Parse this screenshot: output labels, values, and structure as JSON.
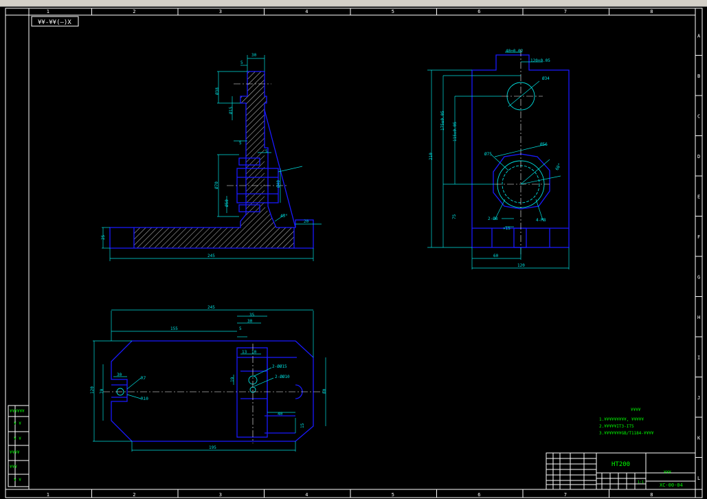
{
  "sheet": {
    "col_labels": [
      "1",
      "2",
      "3",
      "4",
      "5",
      "6",
      "7",
      "8"
    ],
    "row_labels": [
      "A",
      "B",
      "C",
      "D",
      "E",
      "F",
      "G",
      "H",
      "I",
      "J",
      "K",
      "L"
    ],
    "view_label": "¥¥-¥¥(—)X",
    "left_strip": [
      "¥¥¥¥¥¥",
      "¥ ¥",
      "¥ ¥",
      "¥¥¥¥",
      "¥¥¥",
      "¥ ¥"
    ]
  },
  "front_view": {
    "dims": {
      "top_width": "30",
      "top_step": "5",
      "dia_upper": "Ø38",
      "dia_upper2": "Ø15",
      "step_mid": "5",
      "step_mid2": "5",
      "dia_bore": "Ø40",
      "dia_side": "Ø70",
      "dia_low": "Ø50",
      "base_height": "25",
      "total_width": "245",
      "foot_width": "20",
      "rib_angle": "45°"
    }
  },
  "side_view": {
    "dims": {
      "top_center": "40±0.02",
      "top_offset": "120±0.05",
      "hole_dia": "Ø34",
      "h1": "175±0.05",
      "h2": "115±0.05",
      "total_h": "210",
      "bolt_circle": "Ø75",
      "bore_dia": "Ø56",
      "angle": "60°",
      "low_h": "75",
      "pin_holes": "2-Ø8",
      "thread": "4-M8",
      "slot": "×15",
      "half_w": "60",
      "total_w": "120"
    }
  },
  "top_view": {
    "dims": {
      "total_len": "245",
      "w35": "35",
      "w30": "30",
      "len155": "155",
      "s5": "5",
      "d13": "13",
      "d10": "10",
      "holes_a": "2-ØØ15",
      "holes_b": "2-ØØ10",
      "d19": "19",
      "d30": "30",
      "r7": "R7",
      "r10": "R10",
      "h120": "120",
      "h70": "70",
      "h80": "80",
      "d40": "40",
      "d15": "15",
      "len195": "195"
    }
  },
  "notes": {
    "title": "¥¥¥¥",
    "lines": [
      "1.¥¥¥¥¥¥¥¥¥, ¥¥¥¥¥",
      "2.¥¥¥¥¥IT3-IT5",
      "3.¥¥¥¥¥¥¥GB/T1184-¥¥¥¥"
    ]
  },
  "title_block": {
    "material": "HT200",
    "part_name": "¥¥¥",
    "drawing_no": "XC-00-04",
    "scale": "1:1"
  },
  "colors": {
    "frame": "#ffffff",
    "outline": "#1a1aff",
    "dim": "#00e0e0",
    "hatch": "#ffffff",
    "text": "#00ff00",
    "center": "#ffffff"
  }
}
